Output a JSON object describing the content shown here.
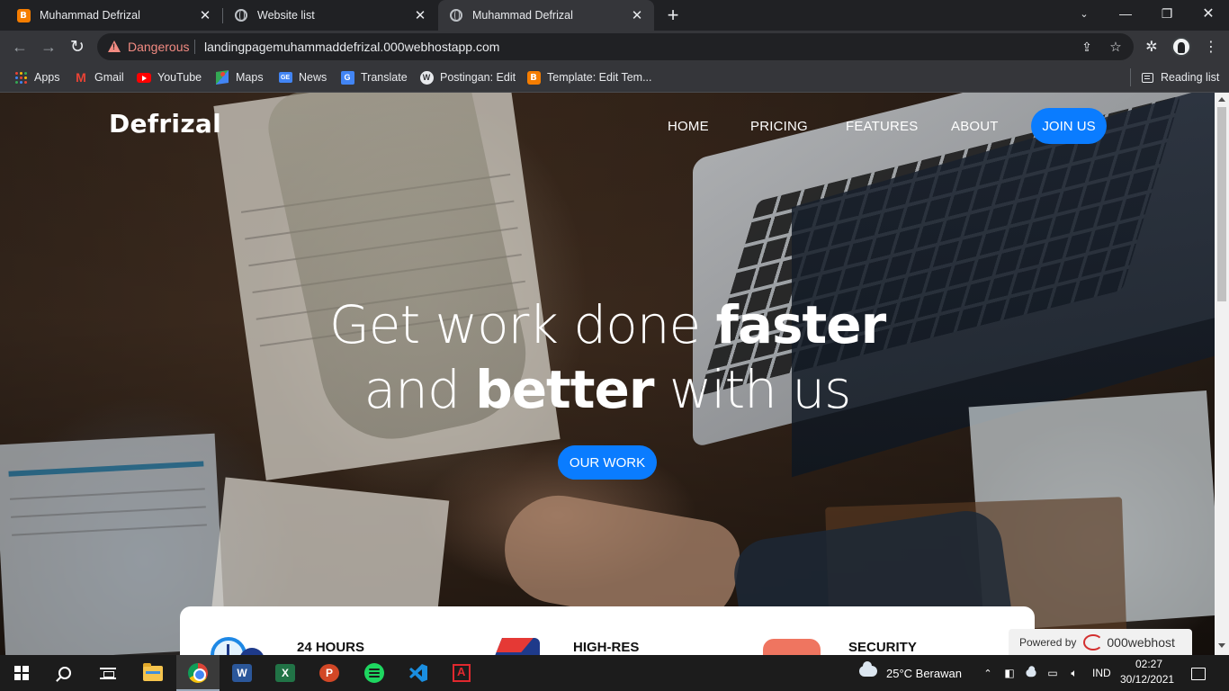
{
  "browser": {
    "tabs": [
      {
        "title": "Muhammad Defrizal",
        "favicon": "blogger-icon",
        "active": false
      },
      {
        "title": "Website list",
        "favicon": "globe-icon",
        "active": false
      },
      {
        "title": "Muhammad Defrizal",
        "favicon": "globe-icon",
        "active": true
      }
    ],
    "new_tab_symbol": "+",
    "close_symbol": "✕",
    "security_label": "Dangerous",
    "url": "landingpagemuhammaddefrizal.000webhostapp.com",
    "bookmarks": [
      {
        "label": "Apps",
        "icon": "apps-grid-icon"
      },
      {
        "label": "Gmail",
        "icon": "gmail-icon"
      },
      {
        "label": "YouTube",
        "icon": "youtube-icon"
      },
      {
        "label": "Maps",
        "icon": "maps-icon"
      },
      {
        "label": "News",
        "icon": "news-icon"
      },
      {
        "label": "Translate",
        "icon": "translate-icon"
      },
      {
        "label": "Postingan: Edit",
        "icon": "wordpress-icon"
      },
      {
        "label": "Template: Edit Tem...",
        "icon": "blogger-icon"
      }
    ],
    "reading_list": "Reading list",
    "colors": {
      "danger": "#f28b82",
      "tab_bg": "#202124",
      "toolbar_bg": "#35363a"
    }
  },
  "site": {
    "brand": "Defrizal",
    "nav": [
      "HOME",
      "PRICING",
      "FEATURES",
      "ABOUT"
    ],
    "cta_nav": "JOIN US",
    "headline": {
      "line1_light": "Get work done ",
      "line1_bold": "faster",
      "line2_light_a": "and ",
      "line2_bold": "better",
      "line2_light_b": " with us"
    },
    "hero_button": "OUR WORK",
    "features": [
      "24 HOURS",
      "HIGH-RES",
      "SECURITY"
    ],
    "accent_color": "#0a7cff"
  },
  "hosting_badge": {
    "prefix": "Powered by",
    "brand": "000webhost"
  },
  "taskbar": {
    "apps": [
      "start-icon",
      "search-icon",
      "task-view-icon",
      "file-explorer-icon",
      "chrome-icon",
      "word-icon",
      "excel-icon",
      "powerpoint-icon",
      "spotify-icon",
      "vscode-icon",
      "acrobat-icon"
    ],
    "weather": "25°C  Berawan",
    "language": "IND",
    "time": "02:27",
    "date": "30/12/2021"
  }
}
